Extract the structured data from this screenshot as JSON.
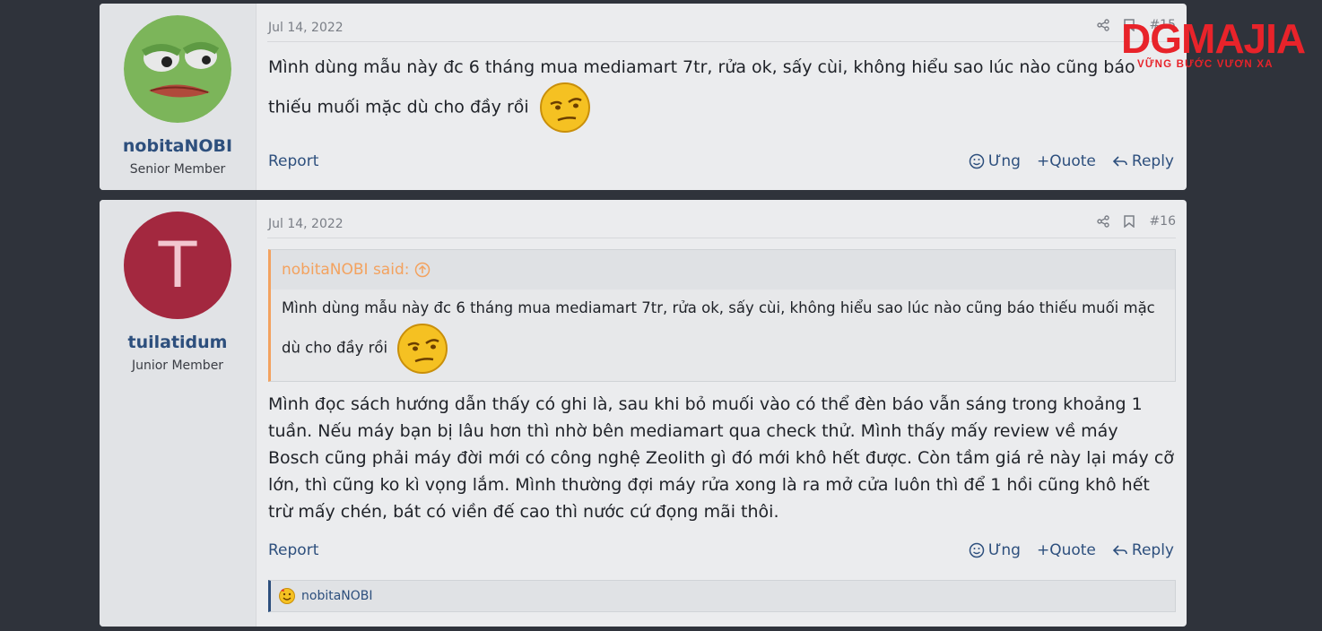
{
  "logo": {
    "text": "DGMAJIA",
    "slogan": "VỮNG BƯỚC VƯƠN XA"
  },
  "posts": [
    {
      "user": {
        "name": "nobitaNOBI",
        "title": "Senior Member",
        "avatar": "pepe-frog-avatar"
      },
      "date": "Jul 14, 2022",
      "number": "#15",
      "body": "Mình dùng mẫu này đc 6 tháng mua mediamart 7tr, rửa ok, sấy cùi, không hiểu sao lúc nào cũng báo thiếu muối mặc dù cho đầy rồi",
      "actions": {
        "report": "Report",
        "react": "Ưng",
        "quote": "+Quote",
        "reply": "Reply"
      }
    },
    {
      "user": {
        "name": "tuilatidum",
        "title": "Junior Member",
        "avatar_letter": "T",
        "avatar_color": "#a3283f"
      },
      "date": "Jul 14, 2022",
      "number": "#16",
      "quote": {
        "author": "nobitaNOBI said:",
        "text": "Mình dùng mẫu này đc 6 tháng mua mediamart 7tr, rửa ok, sấy cùi, không hiểu sao lúc nào cũng báo thiếu muối mặc dù cho đầy rồi"
      },
      "body": "Mình đọc sách hướng dẫn thấy có ghi là, sau khi bỏ muối vào có thể đèn báo vẫn sáng trong khoảng 1 tuần. Nếu máy bạn bị lâu hơn thì nhờ bên mediamart qua check thử. Mình thấy mấy review về máy Bosch cũng phải máy đời mới có công nghệ Zeolith gì đó mới khô hết được. Còn tầm giá rẻ này lại máy cỡ lớn, thì cũng ko kì vọng lắm. Mình thường đợi máy rửa xong là ra mở cửa luôn thì để 1 hồi cũng khô hết trừ mấy chén, bát có viền đế cao thì nước cứ đọng mãi thôi.",
      "actions": {
        "report": "Report",
        "react": "Ưng",
        "quote": "+Quote",
        "reply": "Reply"
      },
      "reactions": {
        "users": "nobitaNOBI"
      }
    }
  ],
  "colors": {
    "accent": "#2d4f7d",
    "quote_border": "#f3a25f",
    "background": "#2f333b"
  }
}
